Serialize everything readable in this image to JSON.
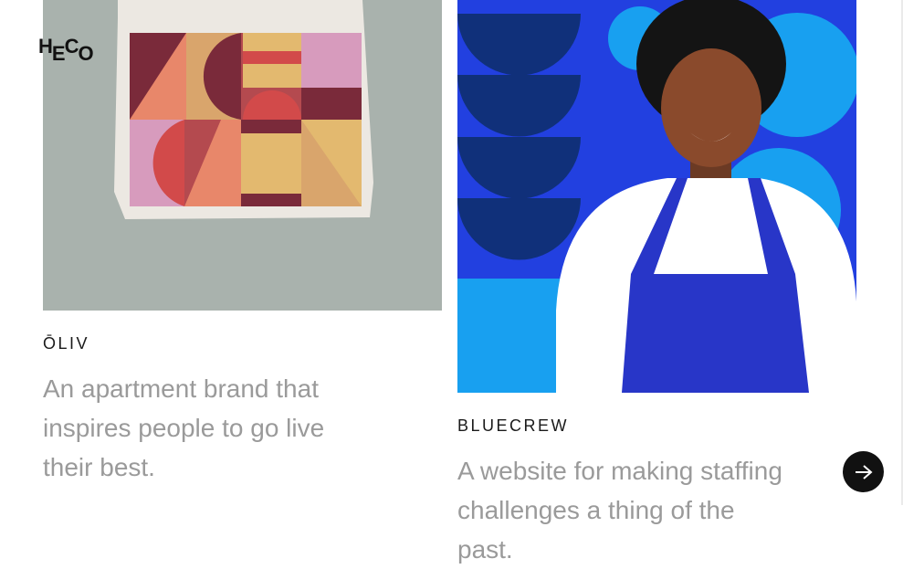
{
  "logo": {
    "letters": [
      "H",
      "E",
      "C",
      "O"
    ]
  },
  "projects": [
    {
      "title": "ŌLIV",
      "description": "An apartment brand that inspires people to go live their best."
    },
    {
      "title": "BLUECREW",
      "description": "A website for making staffing challenges a thing of the past."
    }
  ],
  "icons": {
    "next": "arrow-right-icon"
  },
  "colors": {
    "accent_blue": "#2240e0",
    "light_blue": "#18a0f0",
    "navy": "#10307a",
    "text_muted": "#9a9a9a"
  }
}
